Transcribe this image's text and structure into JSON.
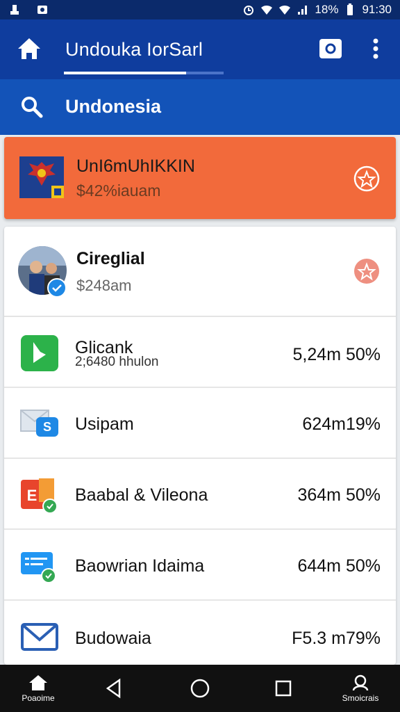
{
  "status_bar": {
    "battery": "18%",
    "time": "91:30",
    "icons": [
      "notification-icon",
      "image-icon",
      "alarm-icon",
      "wifi-icon",
      "wifi-icon",
      "signal-icon",
      "battery-icon"
    ]
  },
  "app_bar": {
    "title": "Undouka IorSarl",
    "icons": [
      "home-icon",
      "camera-icon",
      "more-vert-icon"
    ],
    "accent": "#0f3d9e"
  },
  "search": {
    "value": "Undonesia",
    "icon": "search-icon",
    "background": "#1353b8"
  },
  "highlight": {
    "title": "UnI6mUhIKKIN",
    "subtitle": "$42%iauam",
    "icon": "emblem-icon",
    "background": "#f26a3b"
  },
  "profile": {
    "title": "Cireglial",
    "subtitle": "$248am",
    "icon": "avatar"
  },
  "rows": [
    {
      "title": "Glicank",
      "subtitle": "2;6480 hhulon",
      "value": "5,24m 50%",
      "icon": "green-app-icon"
    },
    {
      "title": "Usipam",
      "subtitle": "",
      "value": "624m19%",
      "icon": "messaging-icon"
    },
    {
      "title": "Baabal & Vileona",
      "subtitle": "",
      "value": "364m 50%",
      "icon": "office-app-icon"
    },
    {
      "title": "Baowrian Idaima",
      "subtitle": "",
      "value": "644m 50%",
      "icon": "chat-app-icon"
    },
    {
      "title": "Budowaia",
      "subtitle": "",
      "value": "F5.3   m79%",
      "icon": "mail-icon"
    }
  ],
  "nav": {
    "left_label": "Poaoime",
    "right_label": "Smoicrais",
    "icons": [
      "home-icon",
      "back-icon",
      "home-circle-icon",
      "recents-icon",
      "user-icon"
    ]
  }
}
